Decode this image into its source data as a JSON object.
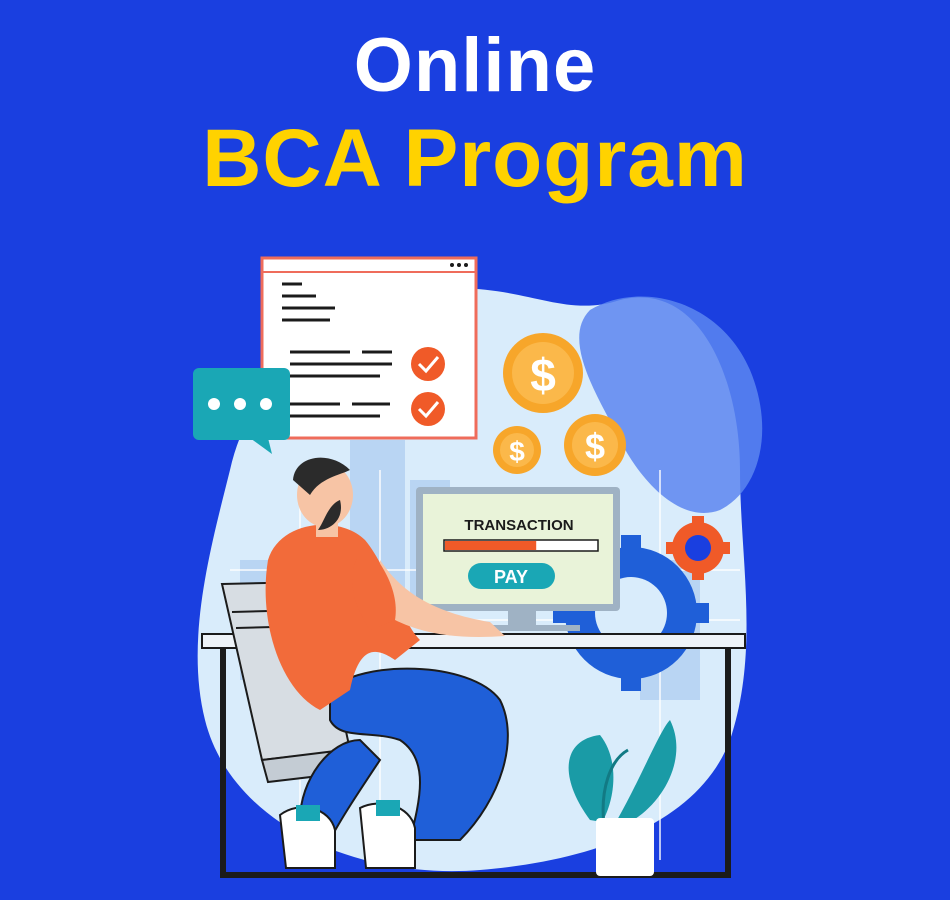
{
  "heading": {
    "line1": "Online",
    "line2": "BCA Program"
  },
  "monitor": {
    "title": "TRANSACTION",
    "progress": 0.6,
    "button_label": "PAY"
  },
  "coins": {
    "symbol": "$"
  },
  "colors": {
    "background": "#1a3fe0",
    "title_white": "#ffffff",
    "title_yellow": "#ffd200",
    "accent_orange": "#f05a28",
    "coin_orange": "#f7a62a",
    "teal": "#1aa7b5",
    "shirt": "#f26b3a",
    "jeans": "#1f5fd8"
  },
  "icons": [
    "chat-bubble-icon",
    "checkmark-icon",
    "dollar-coin-icon",
    "gear-icon",
    "plant-icon"
  ]
}
